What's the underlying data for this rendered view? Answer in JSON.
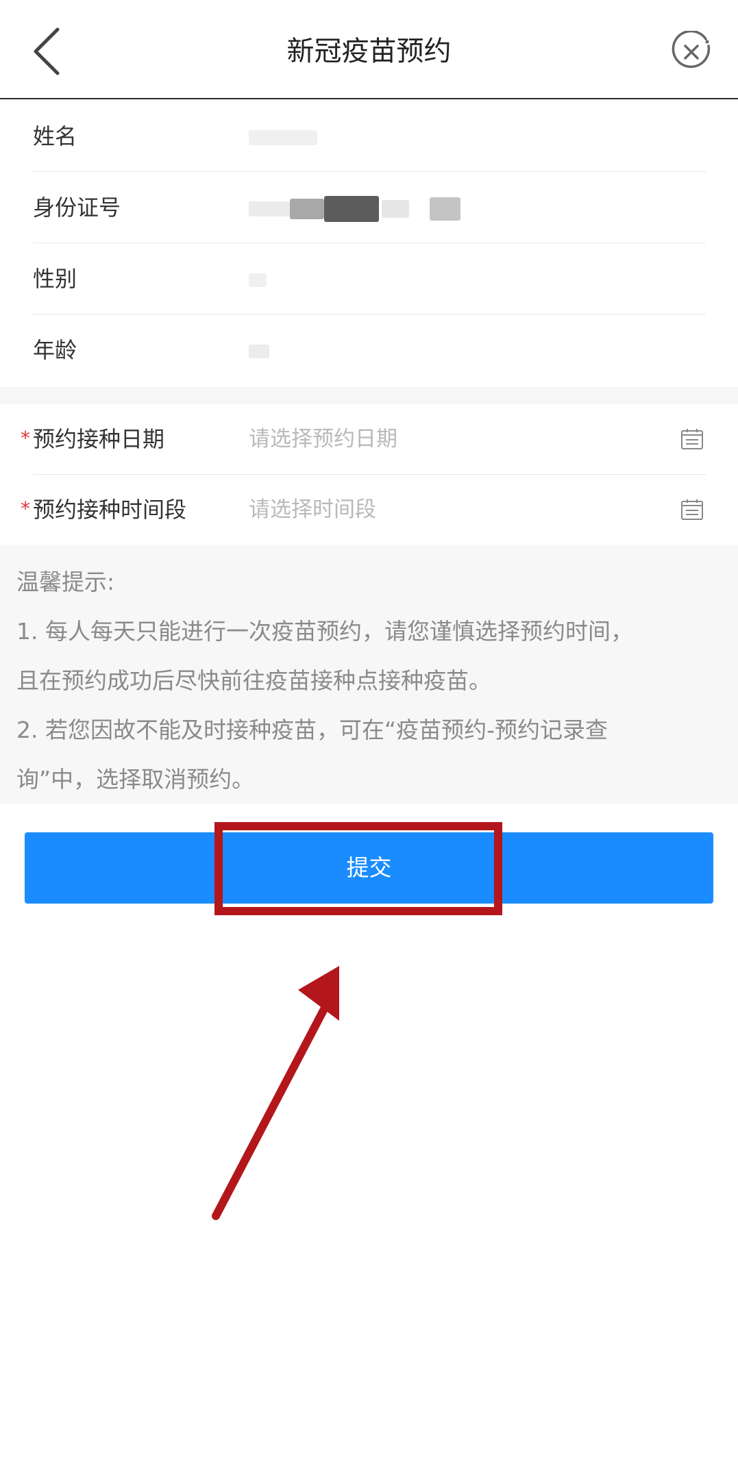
{
  "header": {
    "title": "新冠疫苗预约",
    "back_icon": "chevron-left-icon",
    "close_icon": "close-circle-icon"
  },
  "info": {
    "name_label": "姓名",
    "id_label": "身份证号",
    "gender_label": "性别",
    "age_label": "年龄"
  },
  "appointment": {
    "required_mark": "*",
    "date_label": "预约接种日期",
    "date_placeholder": "请选择预约日期",
    "time_label": "预约接种时间段",
    "time_placeholder": "请选择时间段",
    "calendar_icon": "calendar-icon"
  },
  "tips": {
    "title": "温馨提示:",
    "line1": "1. 每人每天只能进行一次疫苗预约，请您谨慎选择预约时间，",
    "line2": "且在预约成功后尽快前往疫苗接种点接种疫苗。",
    "line3": "2. 若您因故不能及时接种疫苗，可在“疫苗预约-预约记录查",
    "line4": "询”中，选择取消预约。"
  },
  "submit": {
    "label": "提交"
  },
  "colors": {
    "primary": "#1a8cff",
    "required": "#e0343b",
    "annotation": "#b3171b"
  }
}
